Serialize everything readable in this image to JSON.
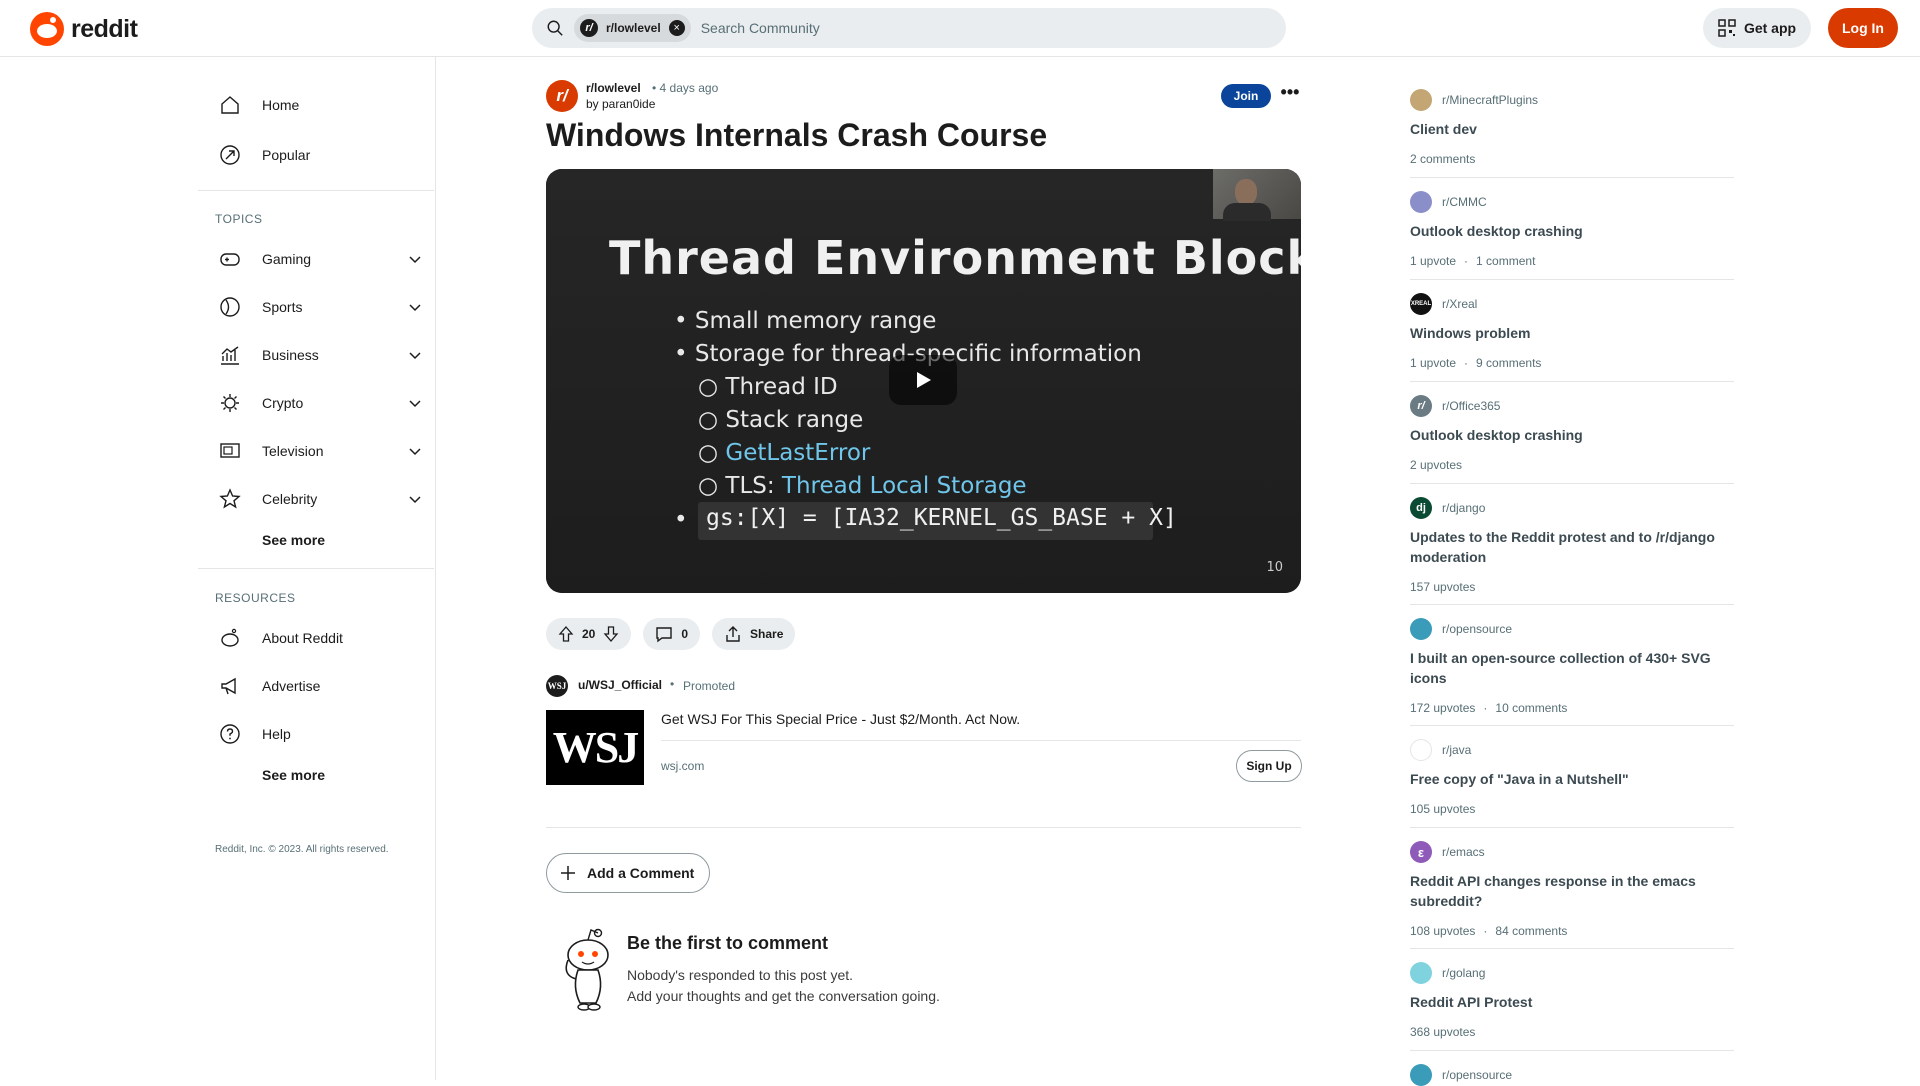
{
  "header": {
    "logo_text": "reddit",
    "search_chip": "r/lowlevel",
    "search_placeholder": "Search Community",
    "get_app": "Get app",
    "login": "Log In"
  },
  "sidebar": {
    "home": "Home",
    "popular": "Popular",
    "topics_title": "TOPICS",
    "topics": [
      {
        "label": "Gaming",
        "icon": "gamepad-icon"
      },
      {
        "label": "Sports",
        "icon": "ball-icon"
      },
      {
        "label": "Business",
        "icon": "chart-icon"
      },
      {
        "label": "Crypto",
        "icon": "crypto-icon"
      },
      {
        "label": "Television",
        "icon": "tv-icon"
      },
      {
        "label": "Celebrity",
        "icon": "star-icon"
      }
    ],
    "topics_see_more": "See more",
    "resources_title": "RESOURCES",
    "resources": [
      {
        "label": "About Reddit",
        "icon": "reddit-icon"
      },
      {
        "label": "Advertise",
        "icon": "megaphone-icon"
      },
      {
        "label": "Help",
        "icon": "help-icon"
      }
    ],
    "resources_see_more": "See more",
    "copyright": "Reddit, Inc. © 2023. All rights reserved."
  },
  "post": {
    "subreddit": "r/lowlevel",
    "time": "• 4 days ago",
    "author": "by paran0ide",
    "join": "Join",
    "more": "•••",
    "title": "Windows Internals Crash Course",
    "slide": {
      "title": "Thread Environment Block",
      "bullet1": "Small memory range",
      "bullet2": "Storage for thread-specific information",
      "sub1": "Thread ID",
      "sub2": "Stack range",
      "sub3": "GetLastError",
      "sub4_prefix": "TLS: ",
      "sub4_hl": "Thread Local Storage",
      "code": "gs:[X] = [IA32_KERNEL_GS_BASE + X]",
      "page": "10"
    },
    "votes": "20",
    "comments": "0",
    "share": "Share"
  },
  "promo": {
    "avatar": "WSJ",
    "user": "u/WSJ_Official",
    "dot": "•",
    "tag": "Promoted",
    "thumb": "WSJ",
    "headline": "Get WSJ For This Special Price - Just $2/Month. Act Now.",
    "domain": "wsj.com",
    "cta": "Sign Up"
  },
  "comments": {
    "add": "Add a Comment",
    "empty_title": "Be the first to comment",
    "empty_line1": "Nobody's responded to this post yet.",
    "empty_line2": "Add your thoughts and get the conversation going."
  },
  "rail": [
    {
      "sub": "r/MinecraftPlugins",
      "title": "Client dev",
      "meta1": "2 comments",
      "meta2": "",
      "color": "#c4a574",
      "av": ""
    },
    {
      "sub": "r/CMMC",
      "title": "Outlook desktop crashing",
      "meta1": "1 upvote",
      "meta2": "1 comment",
      "color": "#8b8fc9",
      "av": ""
    },
    {
      "sub": "r/Xreal",
      "title": "Windows problem",
      "meta1": "1 upvote",
      "meta2": "9 comments",
      "color": "#111111",
      "av": "XREAL"
    },
    {
      "sub": "r/Office365",
      "title": "Outlook desktop crashing",
      "meta1": "2 upvotes",
      "meta2": "",
      "color": "#6b7b84",
      "av": "r/"
    },
    {
      "sub": "r/django",
      "title": "Updates to the Reddit protest and to /r/django moderation",
      "meta1": "157 upvotes",
      "meta2": "",
      "color": "#0c4b33",
      "av": "dj"
    },
    {
      "sub": "r/opensource",
      "title": "I built an open-source collection of 430+ SVG icons",
      "meta1": "172 upvotes",
      "meta2": "10 comments",
      "color": "#3a9cb8",
      "av": ""
    },
    {
      "sub": "r/java",
      "title": "Free copy of \"Java in a Nutshell\"",
      "meta1": "105 upvotes",
      "meta2": "",
      "color": "#ffffff",
      "av": ""
    },
    {
      "sub": "r/emacs",
      "title": "Reddit API changes response in the emacs subreddit?",
      "meta1": "108 upvotes",
      "meta2": "84 comments",
      "color": "#8e5bb8",
      "av": "ε"
    },
    {
      "sub": "r/golang",
      "title": "Reddit API Protest",
      "meta1": "368 upvotes",
      "meta2": "",
      "color": "#7fd3de",
      "av": ""
    },
    {
      "sub": "r/opensource",
      "title": "",
      "meta1": "",
      "meta2": "",
      "color": "#3a9cb8",
      "av": ""
    }
  ]
}
